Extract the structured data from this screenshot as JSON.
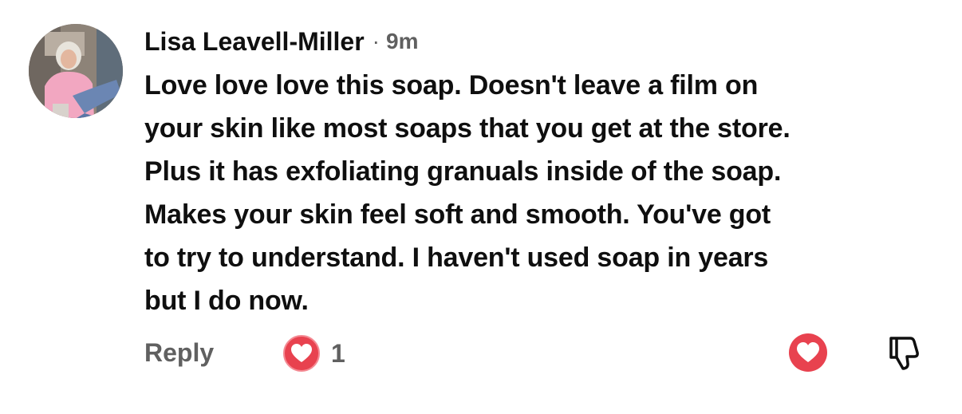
{
  "comment": {
    "author": "Lisa Leavell-Miller",
    "separator": "·",
    "time": "9m",
    "body_lines": [
      "Love love love this soap. Doesn't leave a film on",
      "your skin like most soaps that you get at the store.",
      "Plus it has exfoliating granuals inside of the soap.",
      "Makes your skin feel soft and smooth. You've got",
      "to try to understand. I haven't used soap in years",
      "but I do now."
    ]
  },
  "actions": {
    "reply_label": "Reply",
    "like_count": "1",
    "like_icon": "heart-icon",
    "heart_button_icon": "heart-icon",
    "dislike_icon": "thumbs-down-icon"
  },
  "colors": {
    "text": "#0f0f0f",
    "muted": "#606060",
    "heart": "#e8424f"
  }
}
